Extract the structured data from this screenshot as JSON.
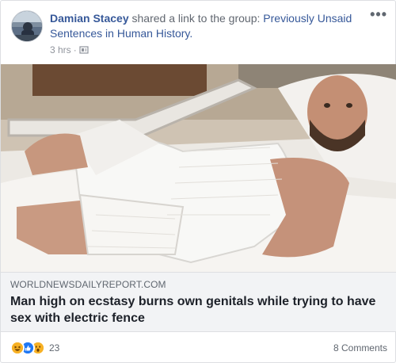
{
  "post": {
    "author": "Damian Stacey",
    "action_text": " shared a link to the group: ",
    "group_name": "Previously Unsaid Sentences in Human History.",
    "timestamp": "3 hrs",
    "dot": "·",
    "privacy_icon": "public-globe-icon",
    "more_icon": "ellipsis-icon",
    "more_label": "•••"
  },
  "link": {
    "domain": "WORLDNEWSDAILYREPORT.COM",
    "headline": "Man high on ecstasy burns own genitals while trying to have sex with electric fence",
    "image_description_icon": "link-preview-image"
  },
  "footer": {
    "reactions": [
      {
        "name": "haha",
        "color": "#f7b125"
      },
      {
        "name": "like",
        "color": "#2078f4"
      },
      {
        "name": "wow",
        "color": "#f7b125"
      }
    ],
    "reaction_count": "23",
    "comments": "8 Comments"
  }
}
